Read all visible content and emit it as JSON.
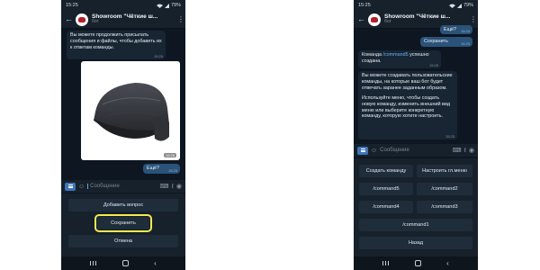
{
  "status": {
    "time": "15:25",
    "battery": "79%"
  },
  "chat": {
    "title": "Showroom \"Чёткие ш...",
    "subtitle": "бот"
  },
  "input": {
    "placeholder": "Сообщение"
  },
  "left": {
    "messages": [
      {
        "text": "Вы можете продолжить присылать сообщения и файлы, чтобы добавить их к ответам команды.",
        "time": "15:25"
      }
    ],
    "photo_time": "15:25",
    "out_message": {
      "text": "Ещё?",
      "time": "15:25"
    },
    "keyboard": [
      "Добавить вопрос",
      "Сохранить",
      "Отмена"
    ]
  },
  "right": {
    "out_top": {
      "text": "Ещё?",
      "time": "15:25"
    },
    "out_saved": {
      "text": "Сохранить",
      "time": "15:25"
    },
    "msg_created": {
      "prefix": "Команда ",
      "command": "/command5",
      "suffix": " успешно создана.",
      "time": "15:25"
    },
    "msg_info": {
      "p1": "Вы можете создавать пользовательские команды, на которые ваш бот будет отвечать заранее заданным образом.",
      "p2": "Используйте меню, чтобы создать новую команду, изменить внешний вид меню или выберите конкретную команду, которую хотите настроить.",
      "time": "15:25"
    },
    "keyboard": {
      "create": "Создать команду",
      "settings": "Настроить гл.меню",
      "cmd5": "/command5",
      "cmd2": "/command2",
      "cmd4": "/command4",
      "cmd3": "/command3",
      "cmd1": "/command1",
      "back": "Назад"
    }
  },
  "colors": {
    "chat_bg": "#0e1621",
    "bar_bg": "#17212b",
    "incoming_bubble": "#182533",
    "outgoing_bubble": "#2b5278",
    "keyboard_button": "#1f2d3b",
    "link": "#6ab3f3",
    "highlight": "#f3e94f"
  },
  "icons": [
    "back-arrow-icon",
    "kebab-menu-icon",
    "bot-menu-icon",
    "emoji-icon",
    "attach-icon",
    "mic-icon",
    "bot-keyboard-icon",
    "read-check-icon"
  ]
}
